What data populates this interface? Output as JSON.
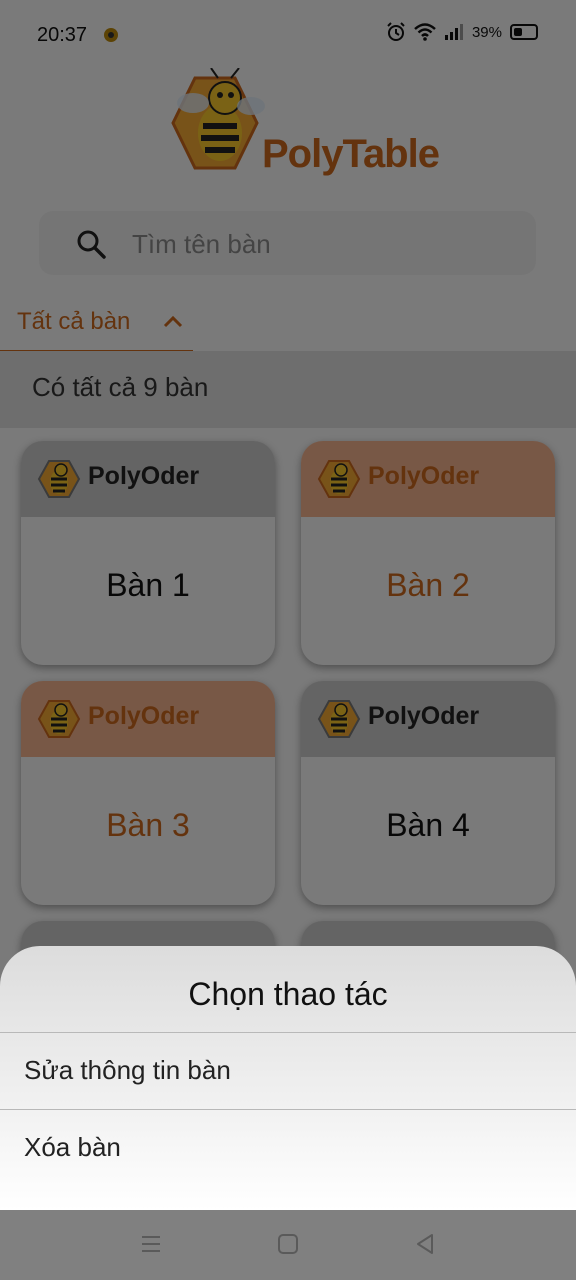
{
  "status_bar": {
    "time": "20:37",
    "battery": "39%",
    "battery_level": 0.39
  },
  "app": {
    "logo_text": "PolyTable"
  },
  "search": {
    "placeholder": "Tìm tên bàn"
  },
  "filter": {
    "label": "Tất cả bàn",
    "count_text": "Có tất cả 9 bàn"
  },
  "tables": [
    {
      "brand": "PolyOder",
      "name": "Bàn 1",
      "status": "gray"
    },
    {
      "brand": "PolyOder",
      "name": "Bàn 2",
      "status": "orange"
    },
    {
      "brand": "PolyOder",
      "name": "Bàn 3",
      "status": "orange"
    },
    {
      "brand": "PolyOder",
      "name": "Bàn 4",
      "status": "gray"
    }
  ],
  "sheet": {
    "title": "Chọn thao tác",
    "actions": [
      "Sửa thông tin bàn",
      "Xóa bàn"
    ]
  },
  "colors": {
    "accent": "#c8661c",
    "card_orange": "#f0b18d",
    "card_gray": "#c8c8c8"
  }
}
